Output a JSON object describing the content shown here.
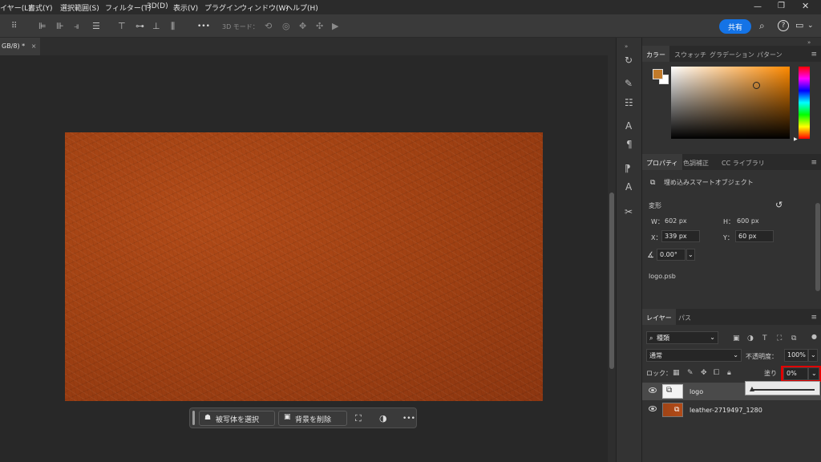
{
  "menubar": {
    "items": [
      "イヤー(L)",
      "書式(Y)",
      "選択範囲(S)",
      "フィルター(T)",
      "3D(D)",
      "表示(V)",
      "プラグイン",
      "ウィンドウ(W)",
      "ヘルプ(H)"
    ]
  },
  "options_bar": {
    "more_label": "•••",
    "mode_3d_label": "3D モード：",
    "share_label": "共有"
  },
  "document_tab": {
    "title": "GB/8) *",
    "close": "×"
  },
  "context_bar": {
    "select_subject": "被写体を選択",
    "remove_bg": "背景を削除",
    "more": "•••"
  },
  "color_panel": {
    "tabs": [
      "カラー",
      "スウォッチ",
      "グラデーション",
      "パターン"
    ],
    "foreground_color": "#c17a2a",
    "background_color": "#ffffff",
    "hue_color": "#ff8a00"
  },
  "properties_panel": {
    "tabs": [
      "プロパティ",
      "色調補正",
      "CC ライブラリ"
    ],
    "object_type": "埋め込みスマートオブジェクト",
    "transform_label": "変形",
    "w_label": "W：",
    "w_value": "602 px",
    "h_label": "H：",
    "h_value": "600 px",
    "x_label": "X：",
    "x_value": "339 px",
    "y_label": "Y：",
    "y_value": "60 px",
    "angle_value": "0.00°",
    "file_name": "logo.psb"
  },
  "layers_panel": {
    "tabs": [
      "レイヤー",
      "パス"
    ],
    "filter_kind": "種類",
    "blend_mode": "通常",
    "opacity_label": "不透明度：",
    "opacity_value": "100%",
    "lock_label": "ロック：",
    "fill_label": "塗り",
    "fill_value": "0%",
    "fill_slider_value": 0,
    "layers": [
      {
        "name": "logo",
        "selected": true
      },
      {
        "name": "leather-2719497_1280",
        "selected": false
      }
    ]
  },
  "colors": {
    "highlight_box": "#e00000",
    "share_button": "#1473e6"
  }
}
